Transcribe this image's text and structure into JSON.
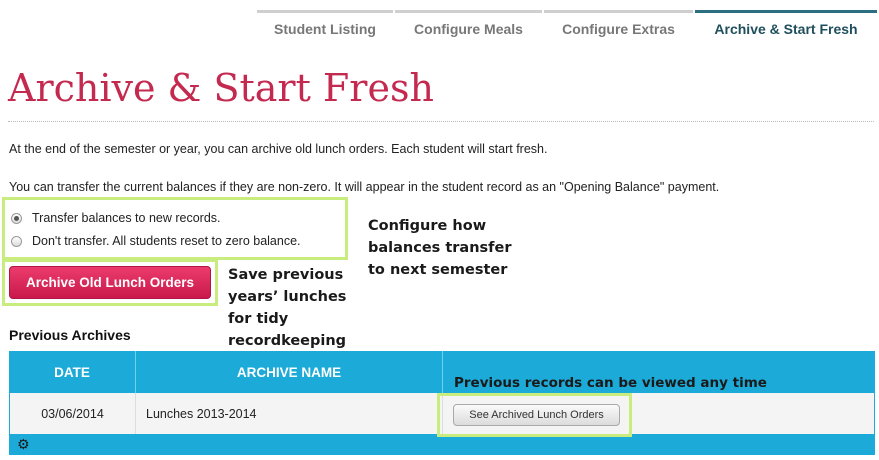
{
  "tabs": [
    {
      "label": "Student Listing"
    },
    {
      "label": "Configure Meals"
    },
    {
      "label": "Configure Extras"
    },
    {
      "label": "Archive & Start Fresh",
      "active": true
    }
  ],
  "page": {
    "title": "Archive & Start Fresh",
    "intro": "At the end of the semester or year, you can archive old lunch orders. Each student will start fresh.",
    "transfer_note": "You can transfer the current balances if they are non-zero. It will appear in the student record as an \"Opening Balance\" payment."
  },
  "options": [
    {
      "label": "Transfer balances to new records.",
      "selected": true
    },
    {
      "label": "Don't transfer. All students reset to zero balance.",
      "selected": false
    }
  ],
  "archive_button": "Archive Old Lunch Orders",
  "annotations": {
    "configure": "Configure how balances transfer to next semester",
    "save": "Save previous years’ lunches for tidy recordkeeping",
    "view": "Previous records can be viewed any time"
  },
  "archives": {
    "title": "Previous Archives",
    "columns": [
      "DATE",
      "ARCHIVE NAME"
    ],
    "rows": [
      {
        "date": "03/06/2014",
        "name": "Lunches 2013-2014",
        "action": "See Archived Lunch Orders"
      }
    ]
  },
  "icons": {
    "settings": "gear-icon"
  },
  "colors": {
    "accent": "#c4294f",
    "button": "#dc2a5c",
    "table_header": "#1cabd9",
    "highlight": "#c9ec7e"
  }
}
